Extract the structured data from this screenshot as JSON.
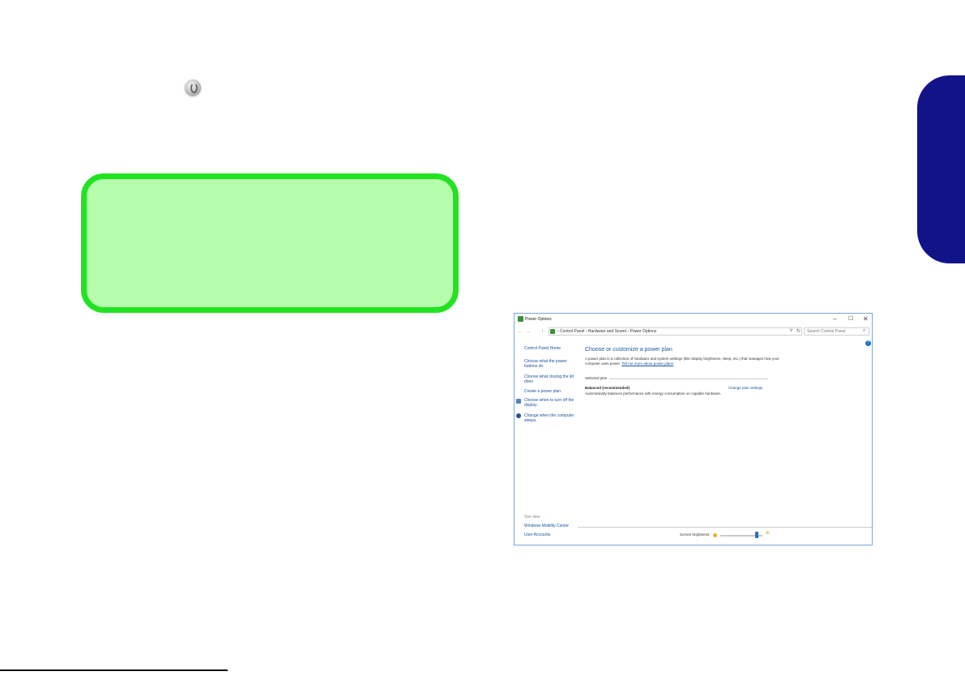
{
  "window": {
    "title": "Power Options",
    "controls": {
      "minimize": "–",
      "maximize": "☐",
      "close": "✕"
    }
  },
  "address": {
    "back": "←",
    "forward": "→",
    "up": "↑",
    "breadcrumb": "› Control Panel › Hardware and Sound › Power Options",
    "dropdown": "v",
    "refresh": "↻",
    "search_placeholder": "Search Control Panel",
    "search_glyph": "⌕"
  },
  "help": "?",
  "left_pane": {
    "home": "Control Panel Home",
    "items": [
      "Choose what the power buttons do",
      "Choose what closing the lid does",
      "Create a power plan",
      "Choose when to turn off the display",
      "Change when the computer sleeps"
    ],
    "see_also": "See also",
    "see_also_items": [
      "Windows Mobility Center",
      "User Accounts"
    ]
  },
  "main": {
    "title": "Choose or customize a power plan",
    "description": "A power plan is a collection of hardware and system settings (like display brightness, sleep, etc.) that manages how your computer uses power.",
    "description_link": "Tell me more about power plans",
    "selected_plan_label": "Selected plan",
    "plan_name": "Balanced (recommended)",
    "change_link": "Change plan settings",
    "plan_description": "Automatically balances performance with energy consumption on capable hardware."
  },
  "brightness": {
    "label": "Screen brightness:",
    "bright_glyph": "✳",
    "level": 0.9
  },
  "colors": {
    "note_fill": "#b5fdad",
    "note_border": "#22e322",
    "side_tab": "#131388",
    "link": "#1a4f9c"
  }
}
